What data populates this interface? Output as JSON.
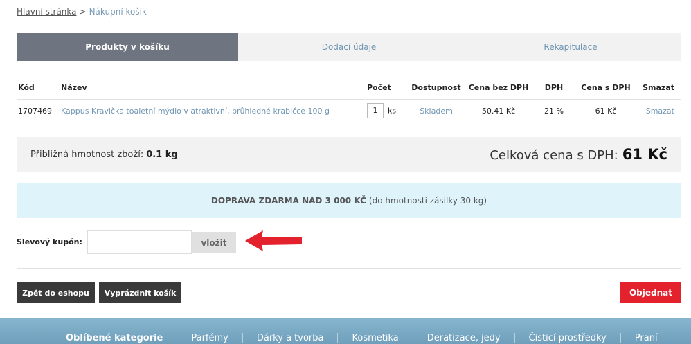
{
  "breadcrumb": {
    "home": "Hlavní stránka",
    "separator": ">",
    "current": "Nákupní košík"
  },
  "steps": [
    {
      "label": "Produkty v košíku",
      "active": true
    },
    {
      "label": "Dodací údaje",
      "active": false
    },
    {
      "label": "Rekapitulace",
      "active": false
    }
  ],
  "table": {
    "headers": {
      "code": "Kód",
      "name": "Název",
      "qty": "Počet",
      "avail": "Dostupnost",
      "price": "Cena bez DPH",
      "vat": "DPH",
      "price_vat": "Cena s DPH",
      "delete": "Smazat"
    },
    "rows": [
      {
        "code": "1707469",
        "name": "Kappus Kravička toaletní mýdlo v atraktivní, průhledné krabičce 100 g",
        "qty": "1",
        "unit": "ks",
        "avail": "Skladem",
        "price": "50.41 Kč",
        "vat": "21 %",
        "price_vat": "61 Kč",
        "delete": "Smazat"
      }
    ]
  },
  "summary": {
    "weight_label": "Přibližná hmotnost zboží:",
    "weight_value": "0.1 kg",
    "total_label": "Celková cena s DPH:",
    "total_value": "61 Kč"
  },
  "shipping": {
    "bold": "DOPRAVA ZDARMA NAD 3 000 KČ",
    "rest": "(do hmotnosti zásilky 30 kg)"
  },
  "coupon": {
    "label": "Slevový kupón:",
    "value": "",
    "button": "vložit"
  },
  "buttons": {
    "back": "Zpět do eshopu",
    "empty": "Vyprázdnit košík",
    "order": "Objednat"
  },
  "footer": {
    "items": [
      "Oblíbené kategorie",
      "Parfémy",
      "Dárky a tvorba",
      "Kosmetika",
      "Deratizace, jedy",
      "Čisticí prostředky",
      "Praní"
    ]
  },
  "colors": {
    "active_tab": "#6e7480",
    "link": "#6f95b2",
    "order": "#e3222d",
    "shipping_bg": "#dff3fb",
    "arrow": "#e3222d"
  }
}
